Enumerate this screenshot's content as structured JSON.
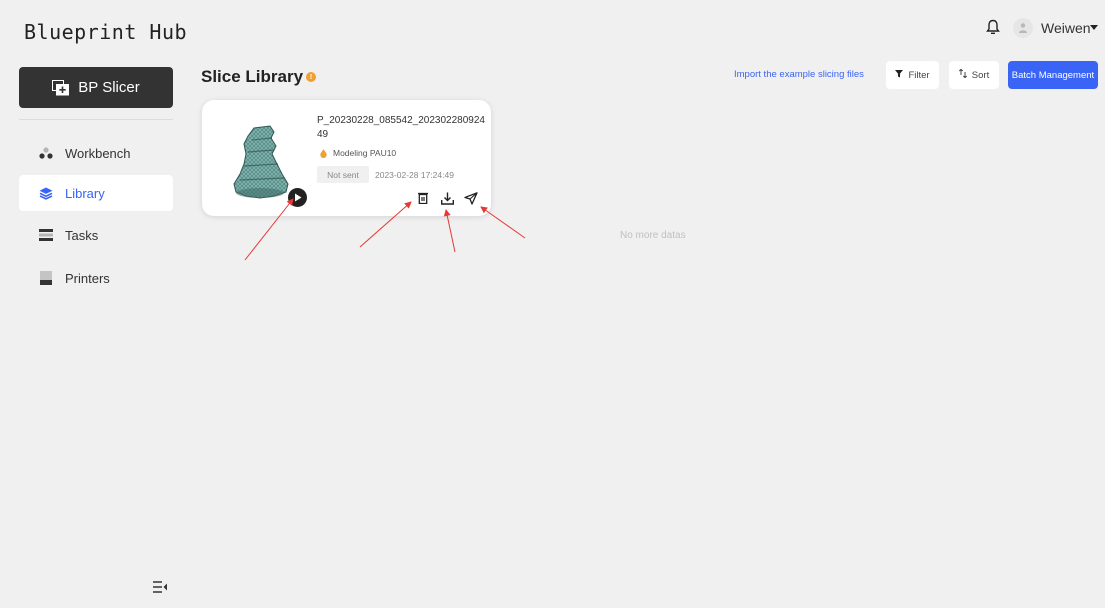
{
  "app": {
    "logo": "Blueprint Hub"
  },
  "header": {
    "username": "Weiwen"
  },
  "sidebar": {
    "slicer_button": "BP Slicer",
    "items": [
      {
        "label": "Workbench",
        "icon": "workbench-icon"
      },
      {
        "label": "Library",
        "icon": "library-icon",
        "active": true
      },
      {
        "label": "Tasks",
        "icon": "tasks-icon"
      },
      {
        "label": "Printers",
        "icon": "printers-icon"
      }
    ]
  },
  "page": {
    "title": "Slice Library",
    "info_dot": "!"
  },
  "toolbar": {
    "import_link": "Import the example slicing files",
    "filter_label": "Filter",
    "sort_label": "Sort",
    "batch_label": "Batch Management"
  },
  "card": {
    "file_name": "P_20230228_085542_20230228092449",
    "material": "Modeling PAU10",
    "status": "Not sent",
    "timestamp": "2023-02-28 17:24:49"
  },
  "list": {
    "empty_text": "No more datas"
  },
  "colors": {
    "accent": "#3a64f5",
    "dark_button": "#333333",
    "warning_dot": "#f0a030",
    "annotation_arrow": "#e53935"
  }
}
